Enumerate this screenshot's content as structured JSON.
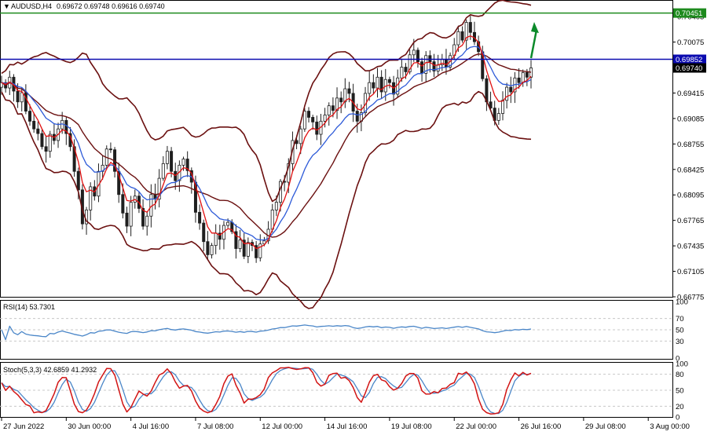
{
  "window": {
    "symbol_title": "AUDUSD,H4",
    "ohlc": "0.69672 0.69748 0.69616 0.69740"
  },
  "colors": {
    "price_candles": "#1f1f1f",
    "bollinger": "#6b1010",
    "ma_fast": "#e01010",
    "ma_slow": "#2d5ad8",
    "resistance_line": "#1e8a1e",
    "support_line": "#0b0bb0",
    "arrow": "#0b8a2a",
    "rsi_line": "#4a86c8",
    "stoch_main": "#d21414",
    "stoch_signal": "#4a86c8",
    "current_price_box": "#000000",
    "support_box": "#0b0bb0",
    "resistance_box": "#1e8a1e"
  },
  "chart_data": [
    {
      "type": "line",
      "panel": "price",
      "title": "AUDUSD,H4",
      "subtitle": "0.69672 0.69748 0.69616 0.69740",
      "ylim": [
        0.66775,
        0.7062
      ],
      "y_ticks": [
        "0.70405",
        "0.70075",
        "0.69745",
        "0.69415",
        "0.69085",
        "0.68755",
        "0.68425",
        "0.68095",
        "0.67765",
        "0.67435",
        "0.67105",
        "0.66775"
      ],
      "y_tick_values": [
        0.70405,
        0.70075,
        0.69745,
        0.69415,
        0.69085,
        0.68755,
        0.68425,
        0.68095,
        0.67765,
        0.67435,
        0.67105,
        0.66775
      ],
      "x_tick_labels": [
        "27 Jun 2022",
        "30 Jun 00:00",
        "4 Jul 16:00",
        "7 Jul 08:00",
        "12 Jul 00:00",
        "14 Jul 16:00",
        "19 Jul 08:00",
        "22 Jul 00:00",
        "26 Jul 16:00",
        "29 Jul 08:00",
        "3 Aug 00:00"
      ],
      "x_tick_bars": [
        0,
        16,
        32,
        48,
        64,
        80,
        96,
        112,
        128,
        144,
        160
      ],
      "horizontal_levels": [
        {
          "name": "resistance",
          "value": 0.70451,
          "label": "0.70451"
        },
        {
          "name": "support",
          "value": 0.69852,
          "label": "0.69852"
        },
        {
          "name": "current",
          "value": 0.6974,
          "label": "0.69740"
        }
      ],
      "close": [
        0.6955,
        0.6948,
        0.6962,
        0.6944,
        0.693,
        0.6942,
        0.6918,
        0.6905,
        0.6895,
        0.6889,
        0.6872,
        0.6866,
        0.6888,
        0.688,
        0.6895,
        0.6906,
        0.6889,
        0.6872,
        0.684,
        0.6816,
        0.6772,
        0.679,
        0.682,
        0.6808,
        0.684,
        0.6848,
        0.6869,
        0.6868,
        0.684,
        0.681,
        0.6786,
        0.6769,
        0.68,
        0.6808,
        0.6792,
        0.6769,
        0.6782,
        0.681,
        0.6804,
        0.6831,
        0.685,
        0.6866,
        0.684,
        0.6828,
        0.6848,
        0.6856,
        0.6841,
        0.6826,
        0.6787,
        0.6773,
        0.6749,
        0.6732,
        0.6744,
        0.676,
        0.6752,
        0.677,
        0.6774,
        0.6762,
        0.674,
        0.6751,
        0.673,
        0.6748,
        0.6744,
        0.6728,
        0.6746,
        0.675,
        0.6765,
        0.679,
        0.68,
        0.6827,
        0.6826,
        0.685,
        0.688,
        0.6876,
        0.6895,
        0.6918,
        0.691,
        0.6904,
        0.6888,
        0.6905,
        0.6913,
        0.6925,
        0.6919,
        0.6935,
        0.693,
        0.6947,
        0.6941,
        0.6918,
        0.6905,
        0.6916,
        0.6941,
        0.6955,
        0.6948,
        0.6962,
        0.6943,
        0.6959,
        0.6955,
        0.694,
        0.6961,
        0.6975,
        0.6969,
        0.6991,
        0.6997,
        0.6982,
        0.6967,
        0.699,
        0.6982,
        0.697,
        0.6978,
        0.6985,
        0.6975,
        0.699,
        0.7004,
        0.7021,
        0.701,
        0.7033,
        0.702,
        0.7008,
        0.6995,
        0.696,
        0.693,
        0.6922,
        0.6906,
        0.6915,
        0.6932,
        0.6949,
        0.6943,
        0.6961,
        0.6955,
        0.6968,
        0.6962,
        0.6974
      ]
    },
    {
      "type": "line",
      "panel": "rsi",
      "title": "RSI(14) 53.7301",
      "ylim": [
        0,
        100
      ],
      "y_ticks": [
        "100",
        "70",
        "50",
        "30",
        "0"
      ],
      "y_tick_values": [
        100,
        70,
        50,
        30,
        0
      ]
    },
    {
      "type": "line",
      "panel": "stochastic",
      "title": "Stoch(5,3,3) 42.6859 41.2932",
      "ylim": [
        0,
        100
      ],
      "y_ticks": [
        "100",
        "80",
        "50",
        "20",
        "0"
      ],
      "y_tick_values": [
        100,
        80,
        50,
        20,
        0
      ]
    }
  ]
}
